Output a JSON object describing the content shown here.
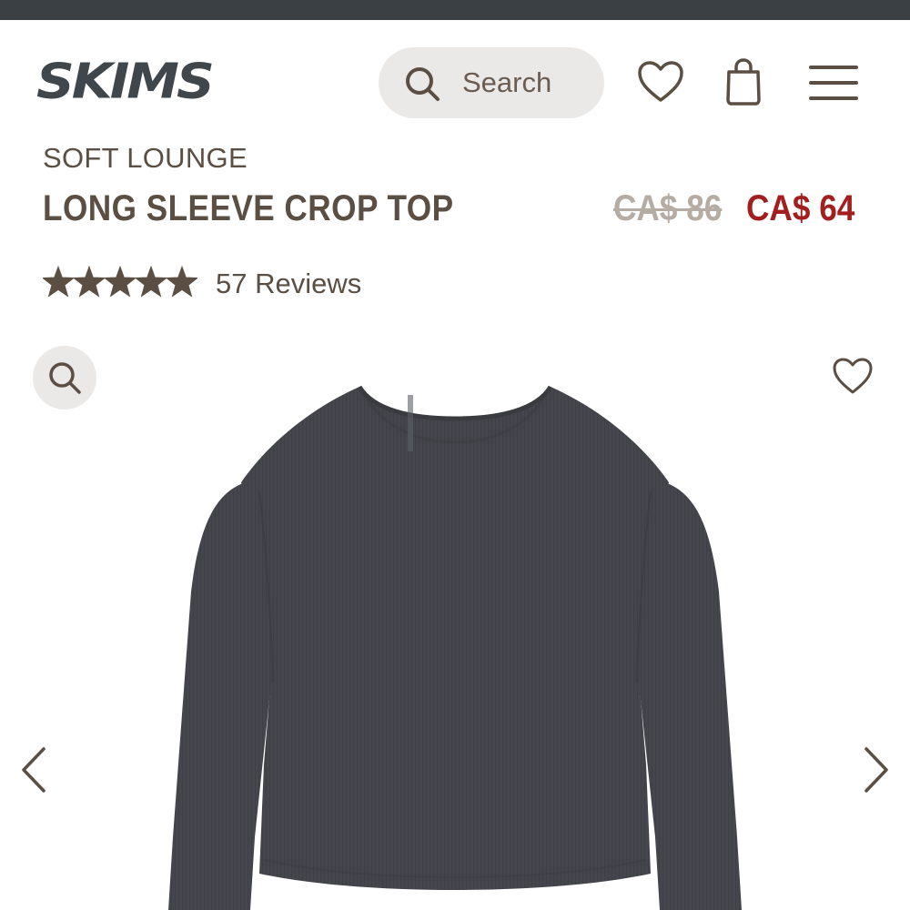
{
  "header": {
    "logo_text": "SKIMS",
    "search_label": "Search",
    "icons": [
      "search-icon",
      "heart-icon",
      "bag-icon",
      "menu-icon"
    ]
  },
  "product": {
    "collection": "SOFT LOUNGE",
    "name": "LONG SLEEVE CROP TOP",
    "price_original": "CA$ 86",
    "price_sale": "CA$ 64",
    "rating_stars": 5,
    "rating_max": 5,
    "reviews_label": "57 Reviews"
  },
  "gallery": {
    "icons": [
      "zoom-icon",
      "heart-icon",
      "chevron-left-icon",
      "chevron-right-icon"
    ],
    "garment_color": "#45464d"
  },
  "colors": {
    "top_strip": "#3b4044",
    "text_brown": "#5b4e43",
    "sale_red": "#a31f1f",
    "strike_gray": "#b5aca4",
    "pill_bg": "#ebe9e7"
  }
}
